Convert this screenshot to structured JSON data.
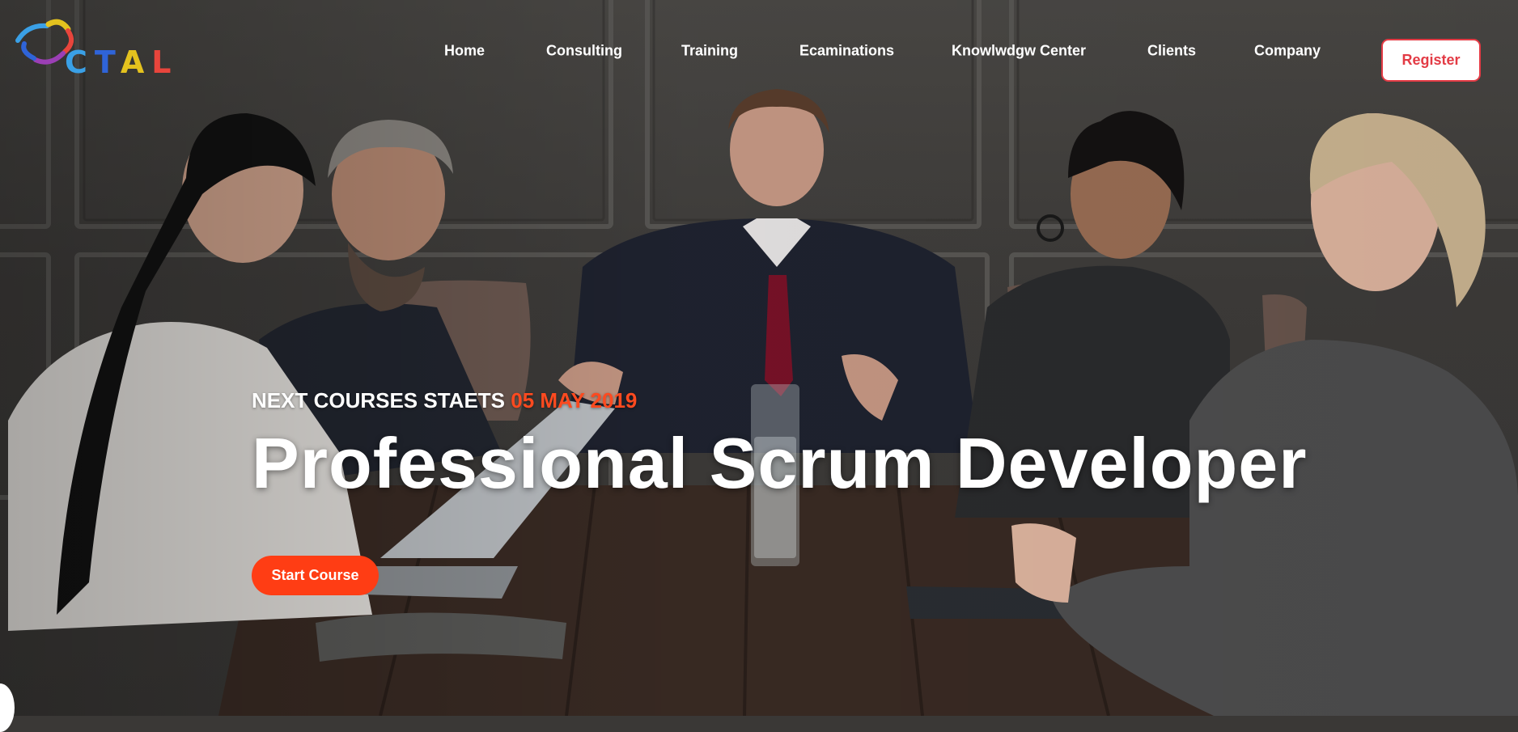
{
  "brand": {
    "logo_text": "CTAL",
    "logo_letters": [
      "C",
      "T",
      "A",
      "L"
    ]
  },
  "nav": {
    "items": [
      {
        "label": "Home"
      },
      {
        "label": "Consulting"
      },
      {
        "label": "Training"
      },
      {
        "label": "Ecaminations"
      },
      {
        "label": "Knowlwdgw Center"
      },
      {
        "label": "Clients"
      },
      {
        "label": "Company"
      }
    ],
    "register_label": "Register"
  },
  "hero": {
    "kicker_prefix": "NEXT COURSES STAETS",
    "kicker_date": "05 MAY 2019",
    "headline": "Professional Scrum Developer",
    "cta_label": "Start Course"
  },
  "colors": {
    "accent": "#ff3d14",
    "register_border": "#e33b45",
    "text": "#ffffff"
  }
}
